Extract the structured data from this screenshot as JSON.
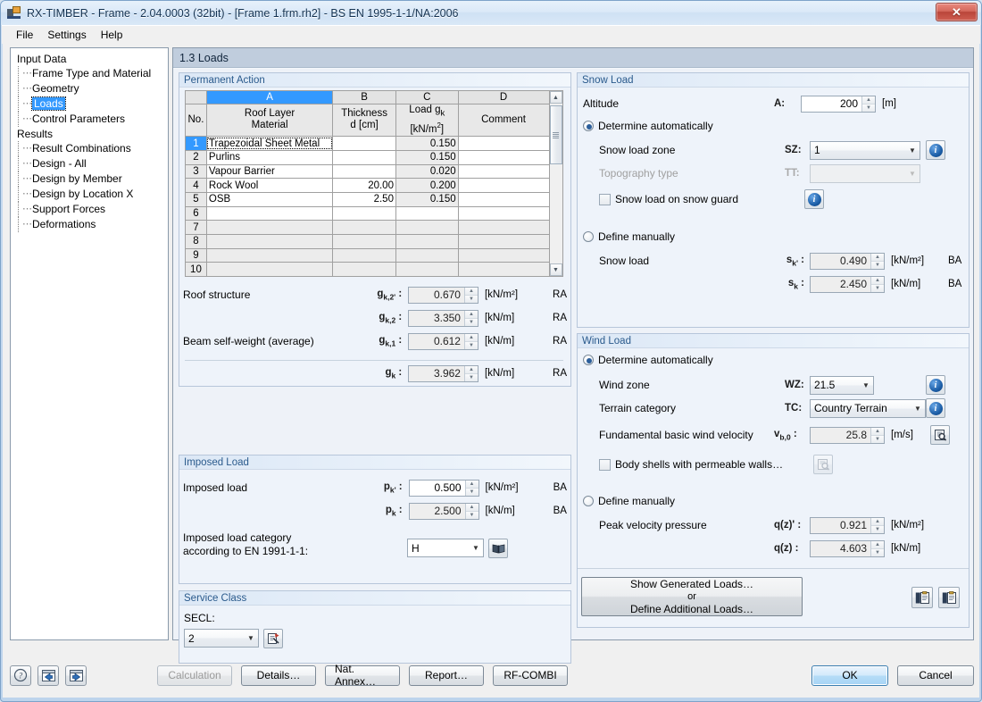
{
  "window": {
    "title": "RX-TIMBER - Frame - 2.04.0003 (32bit) - [Frame 1.frm.rh2] - BS EN 1995-1-1/NA:2006",
    "close_label": "✕"
  },
  "menu": {
    "items": [
      "File",
      "Settings",
      "Help"
    ]
  },
  "tree": {
    "groups": [
      {
        "label": "Input Data",
        "children": [
          "Frame Type and Material",
          "Geometry",
          "Loads",
          "Control Parameters"
        ],
        "selected": "Loads"
      },
      {
        "label": "Results",
        "children": [
          "Result Combinations",
          "Design - All",
          "Design by Member",
          "Design by Location X",
          "Support Forces",
          "Deformations"
        ],
        "selected": ""
      }
    ]
  },
  "content": {
    "header": "1.3 Loads"
  },
  "permanent_action": {
    "title": "Permanent Action",
    "column_letters": [
      "A",
      "B",
      "C",
      "D"
    ],
    "active_column": "A",
    "row_header": "No.",
    "headers": [
      {
        "line1": "Roof Layer",
        "line2": "Material"
      },
      {
        "line1": "Thickness",
        "line2": "d [cm]"
      },
      {
        "line1": "Load g",
        "sub": "k",
        "line2": "[kN/m",
        "sup": "2",
        "line2b": "]"
      },
      {
        "line1": "",
        "line2": "Comment"
      }
    ],
    "rows": [
      {
        "no": "1",
        "material": "Trapezoidal Sheet Metal",
        "thickness": "",
        "load": "0.150",
        "comment": "",
        "selected": true
      },
      {
        "no": "2",
        "material": "Purlins",
        "thickness": "",
        "load": "0.150",
        "comment": "",
        "selected": false
      },
      {
        "no": "3",
        "material": "Vapour Barrier",
        "thickness": "",
        "load": "0.020",
        "comment": "",
        "selected": false
      },
      {
        "no": "4",
        "material": "Rock Wool",
        "thickness": "20.00",
        "load": "0.200",
        "comment": "",
        "selected": false
      },
      {
        "no": "5",
        "material": "OSB",
        "thickness": "2.50",
        "load": "0.150",
        "comment": "",
        "selected": false
      },
      {
        "no": "6",
        "material": "",
        "thickness": "",
        "load": "",
        "comment": "",
        "selected": false
      },
      {
        "no": "7",
        "material": "",
        "thickness": "",
        "load": "",
        "comment": "",
        "selected": false
      },
      {
        "no": "8",
        "material": "",
        "thickness": "",
        "load": "",
        "comment": "",
        "selected": false
      },
      {
        "no": "9",
        "material": "",
        "thickness": "",
        "load": "",
        "comment": "",
        "selected": false
      },
      {
        "no": "10",
        "material": "",
        "thickness": "",
        "load": "",
        "comment": "",
        "selected": false
      }
    ],
    "summary": [
      {
        "label": "Roof structure",
        "symbol": "g",
        "sub": "k,2'",
        "value": "0.670",
        "unit": "[kN/m²]",
        "tag": "RA",
        "readonly": true
      },
      {
        "label": "",
        "symbol": "g",
        "sub": "k,2",
        "value": "3.350",
        "unit": "[kN/m]",
        "tag": "RA",
        "readonly": true
      },
      {
        "label": "Beam self-weight (average)",
        "symbol": "g",
        "sub": "k,1",
        "value": "0.612",
        "unit": "[kN/m]",
        "tag": "RA",
        "readonly": true
      },
      {
        "label": "",
        "symbol": "g",
        "sub": "k",
        "value": "3.962",
        "unit": "[kN/m]",
        "tag": "RA",
        "readonly": true
      }
    ]
  },
  "imposed_load": {
    "title": "Imposed Load",
    "label": "Imposed load",
    "rows": [
      {
        "symbol": "p",
        "sub": "k'",
        "value": "0.500",
        "unit": "[kN/m²]",
        "tag": "BA",
        "readonly": false
      },
      {
        "symbol": "p",
        "sub": "k",
        "value": "2.500",
        "unit": "[kN/m]",
        "tag": "BA",
        "readonly": true
      }
    ],
    "category_label_line1": "Imposed load category",
    "category_label_line2": "according to EN 1991-1-1:",
    "category_value": "H",
    "book_icon": "book-icon"
  },
  "service_class": {
    "title": "Service Class",
    "label": "SECL:",
    "value": "2"
  },
  "snow_load": {
    "title": "Snow Load",
    "altitude_label": "Altitude",
    "altitude_symbol": "A:",
    "altitude_value": "200",
    "altitude_unit": "[m]",
    "auto_label": "Determine automatically",
    "auto_selected": true,
    "zone_label": "Snow load zone",
    "zone_symbol": "SZ:",
    "zone_value": "1",
    "topography_label": "Topography type",
    "topography_symbol": "TT:",
    "topography_value": "",
    "snow_guard_label": "Snow load on snow guard",
    "snow_guard_checked": false,
    "manual_label": "Define manually",
    "manual_selected": false,
    "snow_load_label": "Snow load",
    "rows": [
      {
        "symbol": "s",
        "sub": "k'",
        "value": "0.490",
        "unit": "[kN/m²]",
        "tag": "BA"
      },
      {
        "symbol": "s",
        "sub": "k",
        "value": "2.450",
        "unit": "[kN/m]",
        "tag": "BA"
      }
    ]
  },
  "wind_load": {
    "title": "Wind Load",
    "auto_label": "Determine automatically",
    "auto_selected": true,
    "zone_label": "Wind zone",
    "zone_symbol": "WZ:",
    "zone_value": "21.5",
    "terrain_label": "Terrain category",
    "terrain_symbol": "TC:",
    "terrain_value": "Country Terrain",
    "velocity_label": "Fundamental basic wind velocity",
    "velocity_symbol": "v",
    "velocity_sub": "b,0",
    "velocity_value": "25.8",
    "velocity_unit": "[m/s]",
    "body_shells_label": "Body shells with permeable walls…",
    "body_shells_checked": false,
    "manual_label": "Define manually",
    "manual_selected": false,
    "peak_label": "Peak velocity pressure",
    "rows": [
      {
        "symbol": "q(z)'",
        "value": "0.921",
        "unit": "[kN/m²]"
      },
      {
        "symbol": "q(z)",
        "value": "4.603",
        "unit": "[kN/m]"
      }
    ]
  },
  "loads_action": {
    "line1": "Show Generated Loads…",
    "line2": "or",
    "line3": "Define Additional Loads…"
  },
  "footer": {
    "help_icon": "help-question-icon",
    "prev_icon": "previous-arrow-icon",
    "next_icon": "next-arrow-icon",
    "buttons": [
      {
        "label": "Calculation",
        "disabled": true
      },
      {
        "label": "Details…",
        "disabled": false
      },
      {
        "label": "Nat. Annex…",
        "disabled": false
      },
      {
        "label": "Report…",
        "disabled": false
      },
      {
        "label": "RF-COMBI",
        "disabled": false
      }
    ],
    "ok": "OK",
    "cancel": "Cancel"
  },
  "colors": {
    "accent": "#3399ff",
    "group_title": "#2a5a8c",
    "header_bg": "#c0cddd",
    "close_btn": "#b9453a"
  }
}
